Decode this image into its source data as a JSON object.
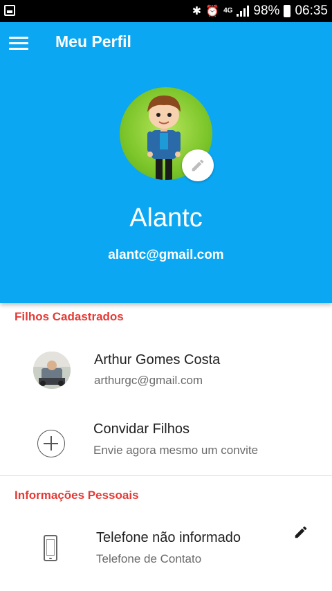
{
  "status_bar": {
    "network": "4G",
    "battery": "98%",
    "time": "06:35"
  },
  "header": {
    "title": "Meu Perfil",
    "menu_icon": "hamburger-menu-icon",
    "background": "#0BA7F2"
  },
  "profile": {
    "name": "Alantc",
    "email": "alantc@gmail.com",
    "edit_icon": "pencil-icon"
  },
  "children_section": {
    "title": "Filhos Cadastrados",
    "children": [
      {
        "name": "Arthur Gomes Costa",
        "email": "arthurgc@gmail.com"
      }
    ],
    "invite": {
      "title": "Convidar Filhos",
      "subtitle": "Envie agora mesmo um convite",
      "icon": "add-circle-icon"
    }
  },
  "personal_section": {
    "title": "Informações Pessoais",
    "phone": {
      "value": "Telefone não informado",
      "label": "Telefone de Contato",
      "icon": "smartphone-icon",
      "edit_icon": "pencil-icon"
    }
  },
  "colors": {
    "accent": "#0BA7F2",
    "section_title": "#E53935"
  }
}
